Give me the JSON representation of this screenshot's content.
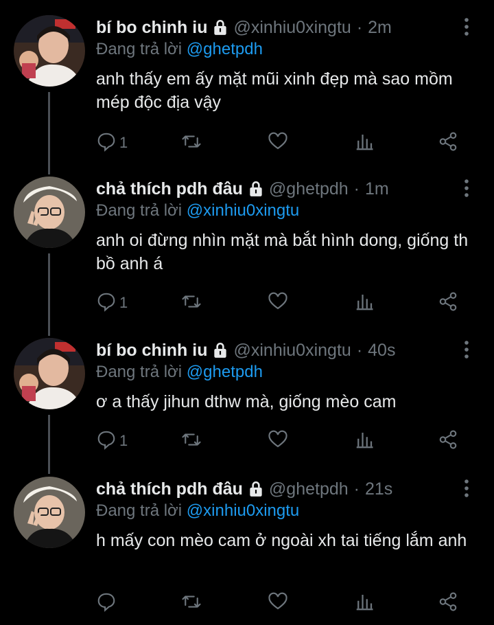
{
  "tweets": [
    {
      "name": "bí bo chinh iu",
      "handle": "@xinhiu0xingtu",
      "dot": "·",
      "time": "2m",
      "reply_prefix": "Đang trả lời",
      "reply_to": "@ghetpdh",
      "text": "anh thấy em ấy mặt mũi xinh đẹp mà sao mồm mép độc địa vậy",
      "reply_count": "1"
    },
    {
      "name": "chả thích pdh đâu",
      "handle": "@ghetpdh",
      "dot": "·",
      "time": "1m",
      "reply_prefix": "Đang trả lời",
      "reply_to": "@xinhiu0xingtu",
      "text": "anh oi đừng nhìn mặt mà bắt hình dong, giống th bồ anh á",
      "reply_count": "1"
    },
    {
      "name": "bí bo chinh iu",
      "handle": "@xinhiu0xingtu",
      "dot": "·",
      "time": "40s",
      "reply_prefix": "Đang trả lời",
      "reply_to": "@ghetpdh",
      "text": "ơ a thấy jihun dthw mà, giống mèo cam",
      "reply_count": "1"
    },
    {
      "name": "chả thích pdh đâu",
      "handle": "@ghetpdh",
      "dot": "·",
      "time": "21s",
      "reply_prefix": "Đang trả lời",
      "reply_to": "@xinhiu0xingtu",
      "text": "h mấy con mèo cam ở ngoài xh tai tiếng lắm anh",
      "reply_count": ""
    }
  ],
  "colors": {
    "background": "#000000",
    "text": "#e7e9ea",
    "muted": "#6e767d",
    "mention": "#1d9bf0",
    "thread_line": "#4a4f55"
  },
  "icons": [
    "lock-icon",
    "more-vertical-icon",
    "reply-icon",
    "retweet-icon",
    "like-icon",
    "analytics-icon",
    "share-icon"
  ]
}
